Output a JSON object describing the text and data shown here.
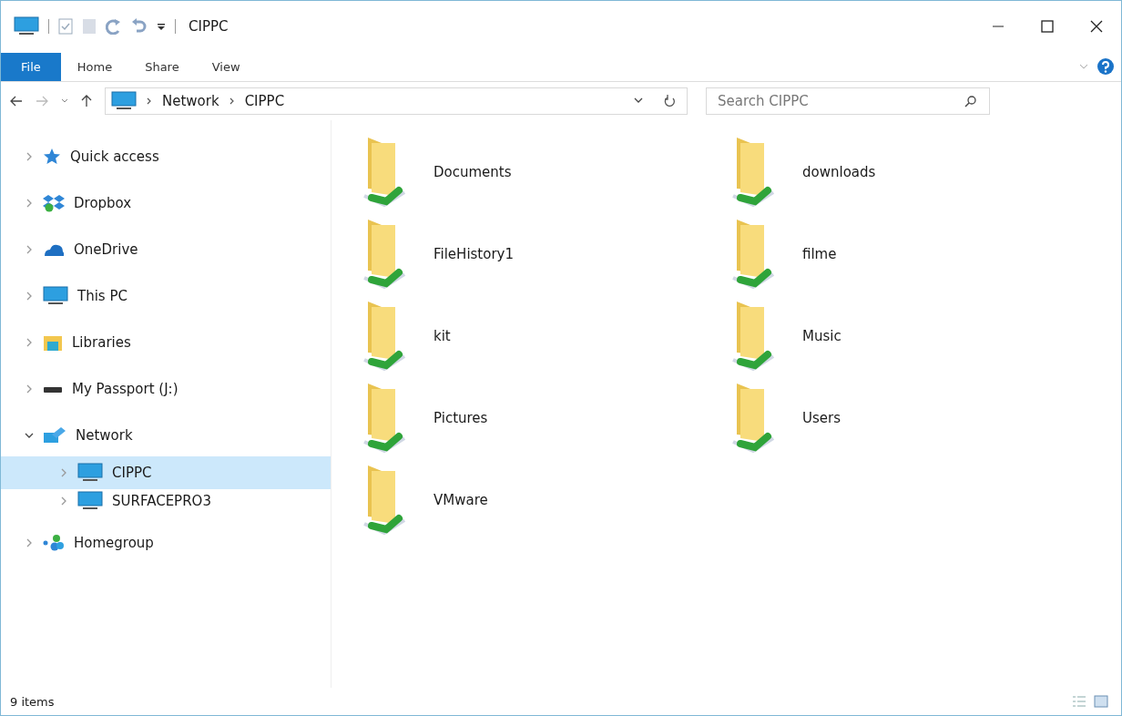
{
  "window": {
    "title": "CIPPC"
  },
  "ribbon_tabs": [
    {
      "label": "File",
      "selected": true
    },
    {
      "label": "Home",
      "selected": false
    },
    {
      "label": "Share",
      "selected": false
    },
    {
      "label": "View",
      "selected": false
    }
  ],
  "address_bar": {
    "breadcrumbs": [
      "Network",
      "CIPPC"
    ]
  },
  "search": {
    "placeholder": "Search CIPPC"
  },
  "sidebar": {
    "items": [
      {
        "label": "Quick access",
        "expanded": false,
        "selected": false
      },
      {
        "label": "Dropbox",
        "expanded": false,
        "selected": false
      },
      {
        "label": "OneDrive",
        "expanded": false,
        "selected": false
      },
      {
        "label": "This PC",
        "expanded": false,
        "selected": false
      },
      {
        "label": "Libraries",
        "expanded": false,
        "selected": false
      },
      {
        "label": "My Passport (J:)",
        "expanded": false,
        "selected": false
      },
      {
        "label": "Network",
        "expanded": true,
        "selected": false,
        "children": [
          {
            "label": "CIPPC",
            "expanded": false,
            "selected": true
          },
          {
            "label": "SURFACEPRO3",
            "expanded": false,
            "selected": false
          }
        ]
      },
      {
        "label": "Homegroup",
        "expanded": false,
        "selected": false
      }
    ]
  },
  "folders": [
    {
      "name": "Documents"
    },
    {
      "name": "downloads"
    },
    {
      "name": "FileHistory1"
    },
    {
      "name": "filme"
    },
    {
      "name": "kit"
    },
    {
      "name": "Music"
    },
    {
      "name": "Pictures"
    },
    {
      "name": "Users"
    },
    {
      "name": "VMware"
    }
  ],
  "status_bar": {
    "item_count": "9 items"
  }
}
